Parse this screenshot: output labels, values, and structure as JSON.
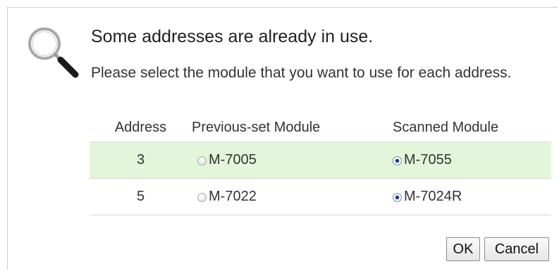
{
  "dialog": {
    "icon": "magnifier-icon",
    "title": "Some addresses are already in use.",
    "message": "Please select the module that you want to use for each address."
  },
  "table": {
    "headers": [
      "Address",
      "Previous-set Module",
      "Scanned Module"
    ],
    "rows": [
      {
        "address": "3",
        "previous": "M-7005",
        "previous_selected": false,
        "scanned": "M-7055",
        "scanned_selected": true
      },
      {
        "address": "5",
        "previous": "M-7022",
        "previous_selected": false,
        "scanned": "M-7024R",
        "scanned_selected": true
      }
    ],
    "highlight_color": "#e4f6d9"
  },
  "buttons": {
    "ok_label": "OK",
    "cancel_label": "Cancel"
  }
}
